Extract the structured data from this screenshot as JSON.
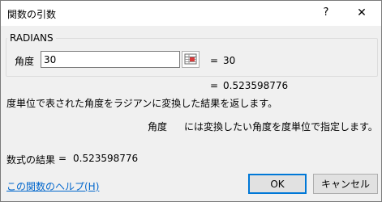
{
  "window": {
    "title": "関数の引数",
    "help_glyph": "?",
    "close_glyph": "✕"
  },
  "function": {
    "name": "RADIANS",
    "argument": {
      "label": "角度",
      "value": "30",
      "eq": "=",
      "evaluated": "30",
      "reference_icon": "collapse-dialog-icon"
    },
    "eq": "=",
    "result_preview": "0.523598776",
    "description": "度単位で表された角度をラジアンに変換した結果を返します。",
    "argument_help": {
      "name": "角度",
      "text": "には変換したい角度を度単位で指定します。"
    }
  },
  "result": {
    "label": "数式の結果",
    "eq": "=",
    "value": "0.523598776"
  },
  "footer": {
    "help_link": "この関数のヘルプ(H)",
    "ok_label": "OK",
    "cancel_label": "キャンセル"
  },
  "colors": {
    "link": "#0066cc",
    "default_button_border": "#0078d7"
  }
}
